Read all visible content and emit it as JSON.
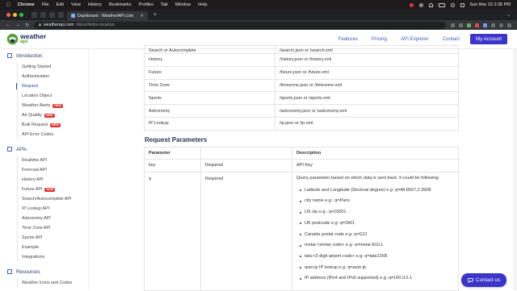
{
  "menubar": {
    "app": "Chrome",
    "items": [
      "File",
      "Edit",
      "View",
      "History",
      "Bookmarks",
      "Profiles",
      "Tab",
      "Window",
      "Help"
    ],
    "clock": "Sun Mar 19  2:36 PM"
  },
  "browser": {
    "tab_title": "Dashboard - WeatherAPI.com",
    "url_host": "weatherapi.com",
    "url_path": "/docs/#intro-location"
  },
  "site": {
    "logo_line1": "weather",
    "logo_line2": "api",
    "nav": [
      "Features",
      "Pricing",
      "API Explorer",
      "Contact"
    ],
    "account_button": "My Account"
  },
  "sidebar": {
    "sections": [
      {
        "title": "Introduction",
        "items": [
          {
            "label": "Getting Started",
            "badge": ""
          },
          {
            "label": "Authentication",
            "badge": ""
          },
          {
            "label": "Request",
            "badge": "",
            "active": true
          },
          {
            "label": "Location Object",
            "badge": ""
          },
          {
            "label": "Weather Alerts",
            "badge": "NEW"
          },
          {
            "label": "Air Quality",
            "badge": "NEW"
          },
          {
            "label": "Bulk Request",
            "badge": "NEW"
          },
          {
            "label": "API Error Codes",
            "badge": ""
          }
        ]
      },
      {
        "title": "APIs",
        "items": [
          {
            "label": "Realtime API",
            "badge": ""
          },
          {
            "label": "Forecast API",
            "badge": ""
          },
          {
            "label": "History API",
            "badge": ""
          },
          {
            "label": "Future API",
            "badge": "NEW"
          },
          {
            "label": "Search/Autocomplete API",
            "badge": ""
          },
          {
            "label": "IP Lookup API",
            "badge": ""
          },
          {
            "label": "Astronomy API",
            "badge": ""
          },
          {
            "label": "Time Zone API",
            "badge": ""
          },
          {
            "label": "Sports API",
            "badge": ""
          },
          {
            "label": "Example",
            "badge": ""
          },
          {
            "label": "Integrations",
            "badge": ""
          }
        ]
      },
      {
        "title": "Resources",
        "items": [
          {
            "label": "Weather Icons and Codes",
            "badge": ""
          }
        ]
      }
    ]
  },
  "endpoints": [
    {
      "name": "Search or Autocomplete",
      "path": "/search.json or /search.xml"
    },
    {
      "name": "History",
      "path": "/history.json or /history.xml"
    },
    {
      "name": "Future",
      "path": "/future.json or /future.xml"
    },
    {
      "name": "Time Zone",
      "path": "/timezone.json or /timezone.xml"
    },
    {
      "name": "Sports",
      "path": "/sports.json or /sports.xml"
    },
    {
      "name": "Astronomy",
      "path": "/astronomy.json or /astronomy.xml"
    },
    {
      "name": "IP Lookup",
      "path": "/ip.json or /ip.xml"
    }
  ],
  "request_params": {
    "heading": "Request Parameters",
    "columns": [
      "Parameter",
      "",
      "Description"
    ],
    "rows": [
      {
        "param": "key",
        "req": "Required",
        "desc": "API Key"
      }
    ],
    "q_row": {
      "param": "q",
      "req": "Required",
      "intro": "Query parameter based on which data is sent back. It could be following:",
      "bullets": [
        "Latitude and Longitude (Decimal degree) e.g: q=48.8567,2.3508",
        "city name e.g.: q=Paris",
        "US zip e.g.: q=10001",
        "UK postcode e.g: q=SW1",
        "Canada postal code e.g: q=G2J",
        "metar:<metar code> e.g: q=metar:EGLL",
        "iata:<3 digit airport code> e.g: q=iata:DXB",
        "auto:ip IP lookup e.g: q=auto:ip",
        "IP address (IPv4 and IPv6 supported) e.g: q=100.0.0.1"
      ]
    }
  },
  "contact_button": "Contact us"
}
